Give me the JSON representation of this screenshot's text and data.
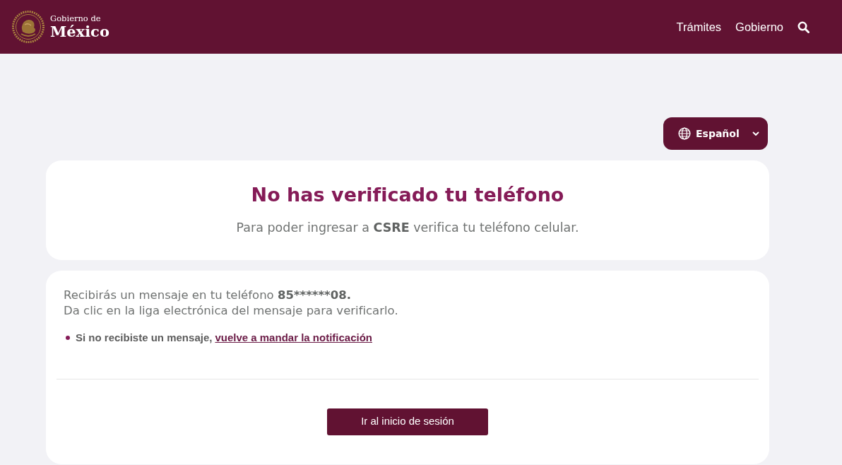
{
  "header": {
    "brand": {
      "line_1": "Gobierno de",
      "line_2": "México"
    },
    "nav": [
      "Trámites",
      "Gobierno"
    ]
  },
  "language_selector": {
    "label": "Español"
  },
  "notice_card": {
    "title": "No has verificado tu teléfono",
    "subtitle": "Para poder ingresar a **CSRE** verifica tu teléfono celular."
  },
  "message_card": {
    "message": "Recibirás un mensaje en tu teléfono",
    "phone": "85******08.",
    "instruction": "Da clic en la liga electrónica del mensaje para verificarlo.",
    "hints": [
      {
        "text": "Si no recibiste un mensaje,",
        "link": "vuelve a mandar la notificación"
      }
    ],
    "button": "Ir al inicio de sesión"
  }
}
